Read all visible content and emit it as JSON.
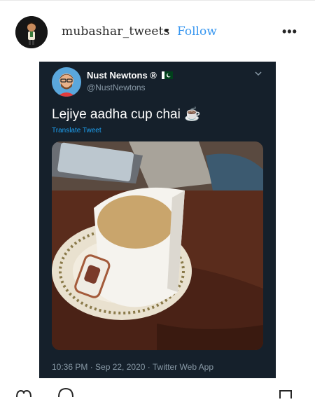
{
  "post": {
    "username": "mubashar_tweets",
    "separator": "•",
    "follow_label": "Follow",
    "more_label": "•••"
  },
  "tweet": {
    "display_name": "Nust Newtons ®",
    "flag_icon": "pakistan-flag-icon",
    "handle": "@NustNewtons",
    "text": "Lejiye aadha cup chai",
    "emoji": "☕",
    "translate_label": "Translate Tweet",
    "meta": "10:36 PM · Sep 22, 2020 · Twitter Web App"
  },
  "colors": {
    "tweet_bg": "#15202b",
    "link": "#3897f0",
    "twitter_blue": "#1da1f2",
    "muted": "#8899a6"
  },
  "icons": [
    "more-icon",
    "chevron-down-icon",
    "heart-icon",
    "comment-icon",
    "bookmark-icon"
  ]
}
